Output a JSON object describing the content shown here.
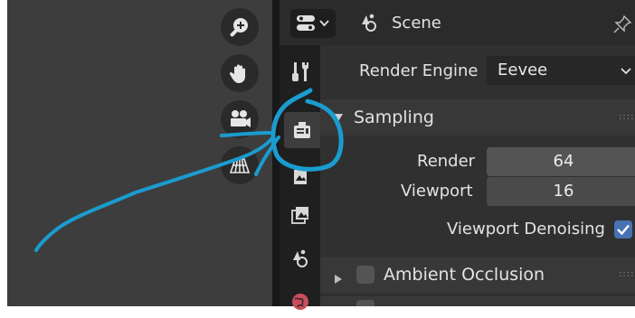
{
  "header": {
    "editor_type_icon": "properties-editor-icon",
    "scene_icon": "scene-icon",
    "title": "Scene",
    "pin_icon": "pin-icon"
  },
  "viewport_nav": [
    {
      "name": "zoom-icon"
    },
    {
      "name": "hand-pan-icon"
    },
    {
      "name": "camera-icon"
    },
    {
      "name": "perspective-grid-icon"
    }
  ],
  "tabs": [
    {
      "name": "tool-tab",
      "icon": "wrench-screwdriver-icon",
      "active": false
    },
    {
      "name": "render-tab",
      "icon": "render-camera-icon",
      "active": true
    },
    {
      "name": "output-tab",
      "icon": "output-printer-icon",
      "active": false
    },
    {
      "name": "view-layer-tab",
      "icon": "view-layer-icon",
      "active": false
    },
    {
      "name": "scene-tab",
      "icon": "scene-icon",
      "active": false
    },
    {
      "name": "world-tab",
      "icon": "world-icon",
      "active": false
    }
  ],
  "render_engine": {
    "label": "Render Engine",
    "value": "Eevee"
  },
  "sampling": {
    "title": "Sampling",
    "render_label": "Render",
    "render_value": "64",
    "viewport_label": "Viewport",
    "viewport_value": "16",
    "denoise_label": "Viewport Denoising",
    "denoise_checked": true
  },
  "ambient_occlusion": {
    "title": "Ambient Occlusion",
    "enabled": false
  },
  "annotation_color": "#1a9ccf"
}
